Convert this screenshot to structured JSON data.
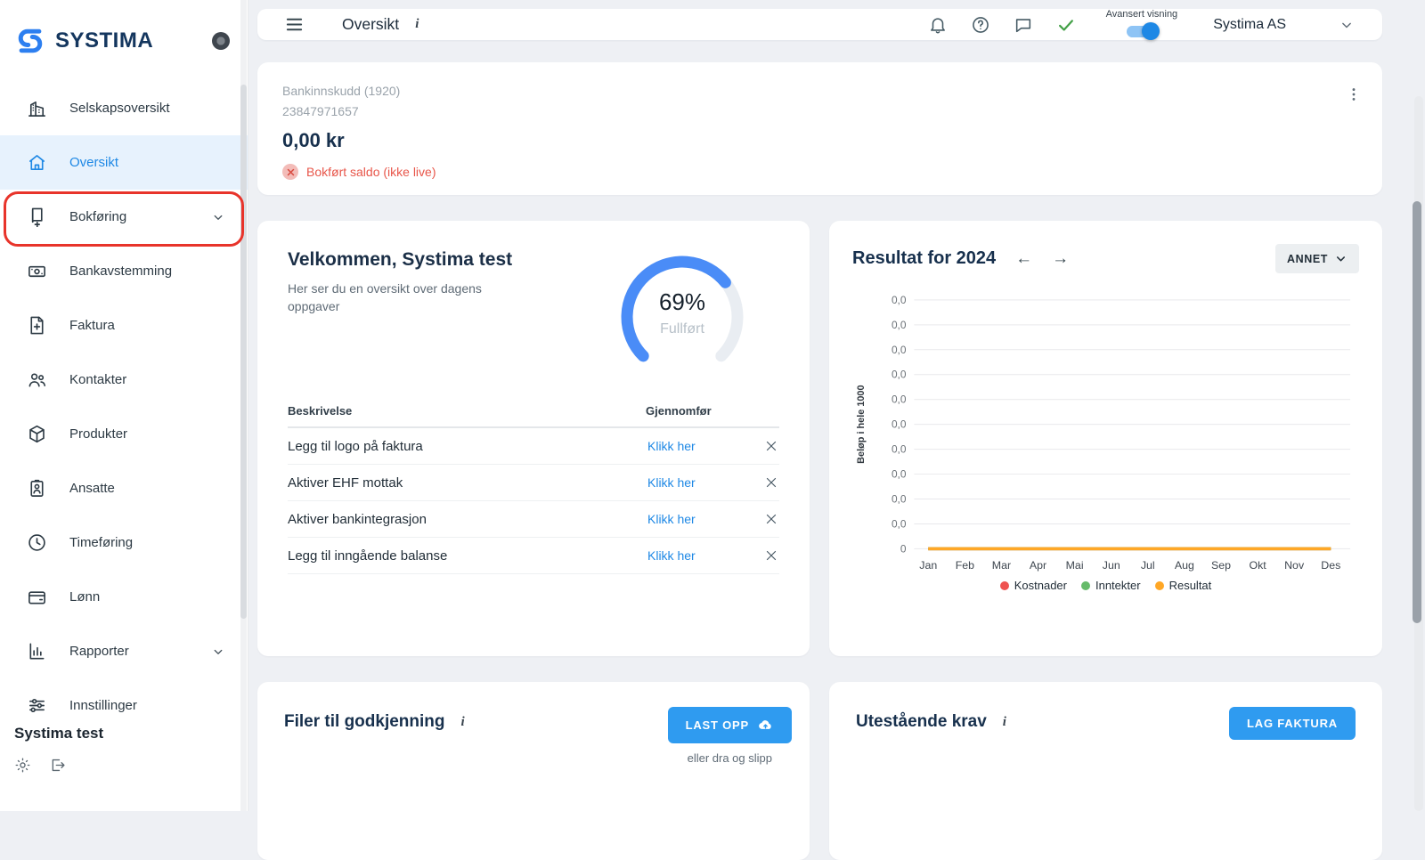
{
  "sidebar": {
    "logo_text": "SYSTIMA",
    "items": [
      {
        "label": "Selskapsoversikt"
      },
      {
        "label": "Oversikt"
      },
      {
        "label": "Bokføring"
      },
      {
        "label": "Bankavstemming"
      },
      {
        "label": "Faktura"
      },
      {
        "label": "Kontakter"
      },
      {
        "label": "Produkter"
      },
      {
        "label": "Ansatte"
      },
      {
        "label": "Timeføring"
      },
      {
        "label": "Lønn"
      },
      {
        "label": "Rapporter"
      },
      {
        "label": "Innstillinger"
      }
    ],
    "user": "Systima test"
  },
  "topbar": {
    "title": "Oversikt",
    "info_icon": "i",
    "advanced_view_label": "Avansert visning",
    "company": "Systima AS"
  },
  "bank_card": {
    "account_name": "Bankinnskudd (1920)",
    "account_number": "23847971657",
    "balance": "0,00 kr",
    "status": "Bokført saldo (ikke live)"
  },
  "welcome_card": {
    "title": "Velkommen, Systima test",
    "subtitle": "Her ser du en oversikt over dagens oppgaver",
    "gauge": {
      "percent": 69,
      "value_label": "69%",
      "caption": "Fullført",
      "color": "#4a8cf7",
      "track_color": "#e9edf2"
    },
    "table": {
      "col_description": "Beskrivelse",
      "col_action": "Gjennomfør",
      "rows": [
        {
          "description": "Legg til logo på faktura",
          "action": "Klikk her"
        },
        {
          "description": "Aktiver EHF mottak",
          "action": "Klikk her"
        },
        {
          "description": "Aktiver bankintegrasjon",
          "action": "Klikk her"
        },
        {
          "description": "Legg til inngående balanse",
          "action": "Klikk her"
        }
      ]
    }
  },
  "result_card": {
    "title": "Resultat for 2024",
    "filter_button": "ANNET",
    "chart_data": {
      "type": "line",
      "title": "Resultat for 2024",
      "categories": [
        "Jan",
        "Feb",
        "Mar",
        "Apr",
        "Mai",
        "Jun",
        "Jul",
        "Aug",
        "Sep",
        "Okt",
        "Nov",
        "Des"
      ],
      "series": [
        {
          "name": "Kostnader",
          "color": "#ef5350",
          "values": [
            0,
            0,
            0,
            0,
            0,
            0,
            0,
            0,
            0,
            0,
            0,
            0
          ]
        },
        {
          "name": "Inntekter",
          "color": "#66bb6a",
          "values": [
            0,
            0,
            0,
            0,
            0,
            0,
            0,
            0,
            0,
            0,
            0,
            0
          ]
        },
        {
          "name": "Resultat",
          "color": "#ffa726",
          "values": [
            0,
            0,
            0,
            0,
            0,
            0,
            0,
            0,
            0,
            0,
            0,
            0
          ]
        }
      ],
      "ylabel": "Beløp i hele 1000",
      "ytick_labels": [
        "0,0",
        "0,0",
        "0,0",
        "0,0",
        "0,0",
        "0,0",
        "0,0",
        "0,0",
        "0,0",
        "0,0",
        "0"
      ],
      "grid": true,
      "legend_position": "bottom"
    }
  },
  "files_card": {
    "title": "Filer til godkjenning",
    "info_icon": "i",
    "upload_button": "LAST OPP",
    "hint": "eller dra og slipp"
  },
  "claims_card": {
    "title": "Utestående krav",
    "info_icon": "i",
    "invoice_button": "LAG FAKTURA"
  }
}
